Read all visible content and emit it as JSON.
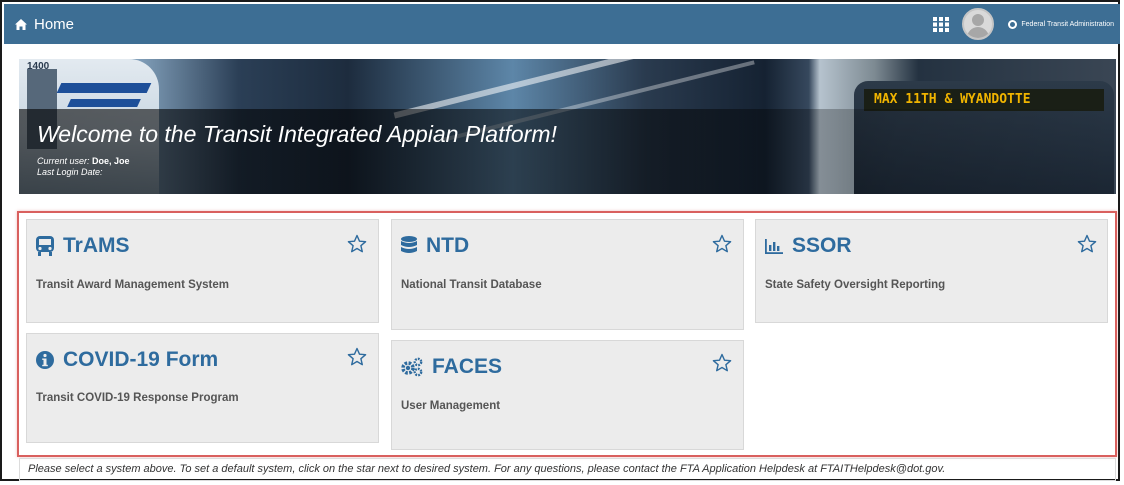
{
  "header": {
    "home_label": "Home",
    "agency_label": "Federal Transit Administration"
  },
  "banner": {
    "welcome": "Welcome to the Transit Integrated Appian Platform!",
    "current_user_label": "Current user:",
    "current_user_value": "Doe, Joe",
    "last_login_label": "Last Login Date:",
    "bus_sign": "MAX  11TH & WYANDOTTE",
    "bus_number": "1400"
  },
  "systems": [
    {
      "name": "TrAMS",
      "description": "Transit Award Management System",
      "icon": "bus-icon"
    },
    {
      "name": "NTD",
      "description": "National Transit Database",
      "icon": "database-icon"
    },
    {
      "name": "SSOR",
      "description": "State Safety Oversight Reporting",
      "icon": "bar-chart-icon"
    },
    {
      "name": "COVID-19 Form",
      "description": "Transit COVID-19 Response Program",
      "icon": "info-icon"
    },
    {
      "name": "FACES",
      "description": "User Management",
      "icon": "gears-icon"
    }
  ],
  "footer_note": "Please select a system above. To set a default system, click on the star next to desired system. For any questions, please contact the FTA Application Helpdesk at FTAITHelpdesk@dot.gov.",
  "colors": {
    "topbar": "#3d6e94",
    "title_blue": "#2e6b9e",
    "highlight": "#d9605e"
  }
}
